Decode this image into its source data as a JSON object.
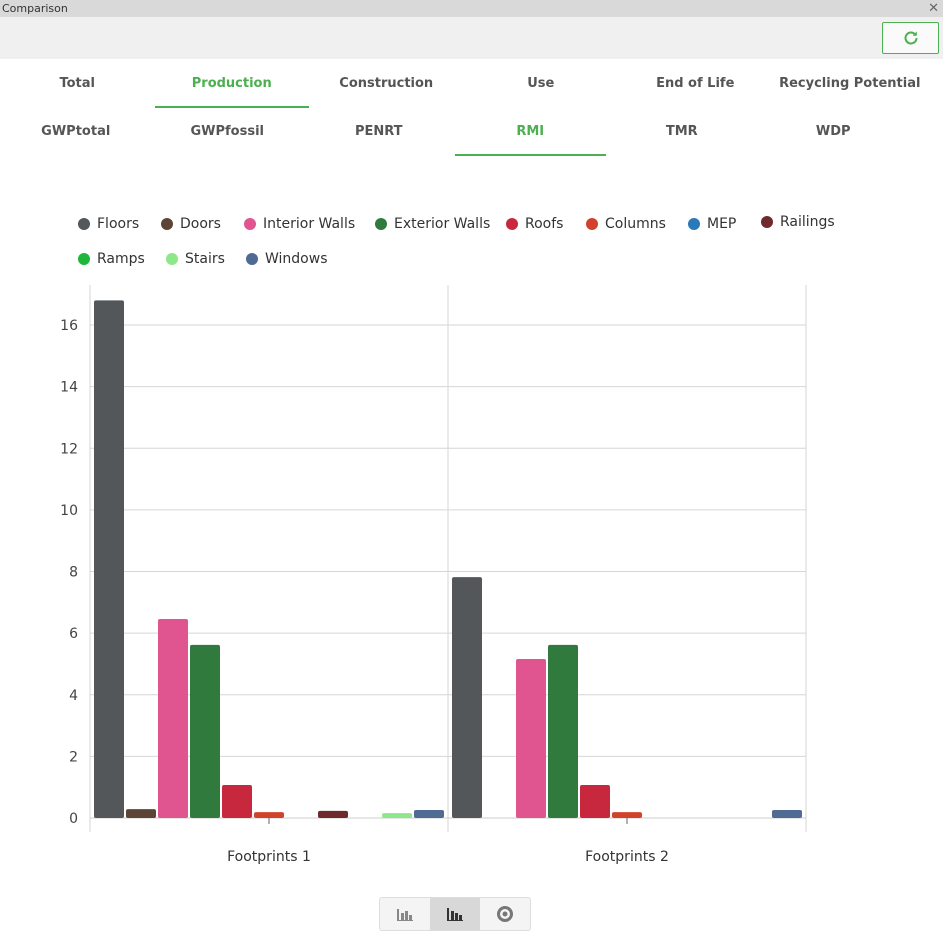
{
  "window": {
    "title": "Comparison",
    "close_icon": "close-icon"
  },
  "toolbar": {
    "refresh_icon": "refresh-icon",
    "accent": "#4caf50"
  },
  "phase_tabs": [
    "Total",
    "Production",
    "Construction",
    "Use",
    "End of Life",
    "Recycling Potential"
  ],
  "phase_active": 1,
  "indicator_tabs": [
    "GWPtotal",
    "GWPfossil",
    "PENRT",
    "RMI",
    "TMR",
    "WDP"
  ],
  "indicator_active": 3,
  "chart_data": {
    "type": "bar",
    "categories": [
      "Footprints 1",
      "Footprints 2"
    ],
    "ylim": [
      0,
      17.3
    ],
    "yticks": [
      0,
      2,
      4,
      6,
      8,
      10,
      12,
      14,
      16
    ],
    "grid": true,
    "legend_position": "top",
    "series": [
      {
        "name": "Floors",
        "color": "#53575a",
        "values": [
          16.8,
          7.82
        ]
      },
      {
        "name": "Doors",
        "color": "#5c4537",
        "values": [
          0.29,
          0
        ]
      },
      {
        "name": "Interior Walls",
        "color": "#e05590",
        "values": [
          6.46,
          5.16
        ]
      },
      {
        "name": "Exterior Walls",
        "color": "#2f7a3c",
        "values": [
          5.62,
          5.62
        ]
      },
      {
        "name": "Roofs",
        "color": "#c8283e",
        "values": [
          1.07,
          1.07
        ]
      },
      {
        "name": "Columns",
        "color": "#d0432a",
        "values": [
          0.19,
          0.19
        ]
      },
      {
        "name": "MEP",
        "color": "#2a79b8",
        "values": [
          0,
          0
        ]
      },
      {
        "name": "Railings",
        "color": "#6e2a2c",
        "values": [
          0.23,
          0
        ]
      },
      {
        "name": "Ramps",
        "color": "#1db83a",
        "values": [
          0,
          0
        ]
      },
      {
        "name": "Stairs",
        "color": "#8ee88a",
        "values": [
          0.16,
          0
        ]
      },
      {
        "name": "Windows",
        "color": "#4f6b93",
        "values": [
          0.26,
          0.26
        ]
      }
    ]
  },
  "chart_switch": {
    "options": [
      "stacked-bar-icon",
      "grouped-bar-icon",
      "donut-icon"
    ],
    "active": 1
  }
}
